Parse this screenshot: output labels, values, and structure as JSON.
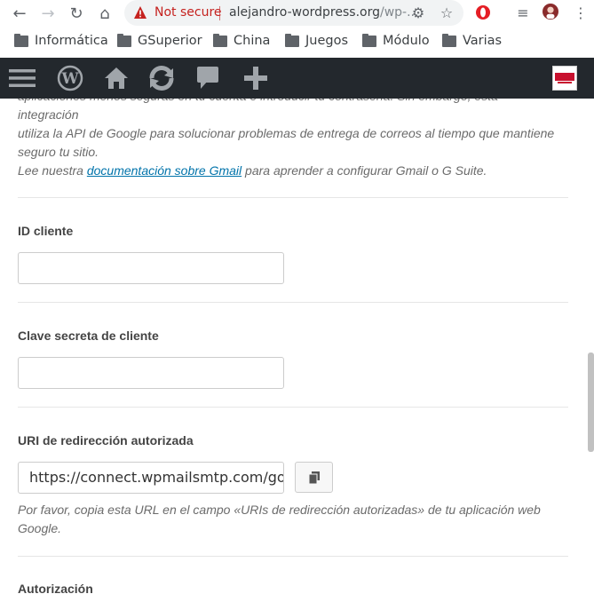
{
  "browser": {
    "security_label": "Not secure",
    "url_host": "alejandro-wordpress.org",
    "url_path": "/wp-...",
    "bookmarks": [
      "Informática",
      "GSuperior",
      "China",
      "Juegos",
      "Módulo",
      "Varias"
    ]
  },
  "adminbar": {
    "icons": [
      "menu-icon",
      "wordpress-icon",
      "home-icon",
      "updates-icon",
      "comments-icon",
      "new-content-icon"
    ]
  },
  "content": {
    "intro_line1": "aplicaciones menos seguras en tu cuenta e introducir tu contraseña. Sin embargo, esta integración",
    "intro_line2": "utiliza la API de Google para solucionar problemas de entrega de correos al tiempo que mantiene",
    "intro_line3": "seguro tu sitio.",
    "docs_prefix": "Lee nuestra ",
    "docs_link": "documentación sobre Gmail",
    "docs_suffix": " para aprender a configurar Gmail o G Suite.",
    "client_id_label": "ID cliente",
    "client_id_value": "",
    "client_secret_label": "Clave secreta de cliente",
    "client_secret_value": "",
    "redirect_label": "URI de redirección autorizada",
    "redirect_value": "https://connect.wpmailsmtp.com/google/",
    "redirect_help_line1": "Por favor, copia esta URL en el campo «URIs de redirección autorizadas» de tu aplicación web",
    "redirect_help_line2": "Google.",
    "authorization_label": "Autorización"
  }
}
